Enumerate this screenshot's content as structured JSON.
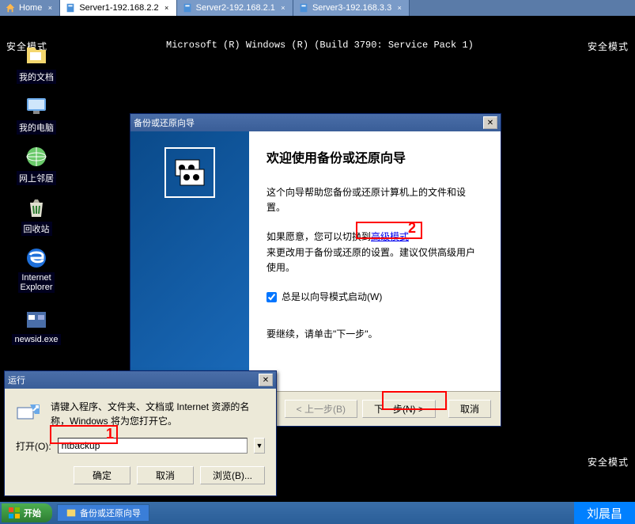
{
  "tabs": {
    "home": "Home",
    "t1": "Server1-192.168.2.2",
    "t2": "Server2-192.168.2.1",
    "t3": "Server3-192.168.3.3"
  },
  "safe_mode": "安全模式",
  "win_build": "Microsoft (R) Windows (R) (Build 3790: Service Pack 1)",
  "desktop_icons": {
    "docs": "我的文档",
    "computer": "我的电脑",
    "network": "网上邻居",
    "recycle": "回收站",
    "ie": "Internet\nExplorer",
    "newsid": "newsid.exe"
  },
  "wizard": {
    "title": "备份或还原向导",
    "heading": "欢迎使用备份或还原向导",
    "p1": "这个向导帮助您备份或还原计算机上的文件和设置。",
    "p2_a": "如果愿意，您可以切换到",
    "p2_link": "高级模式",
    "p2_b": "来更改用于备份或还原的设置。建议仅供高级用户使用。",
    "check": "总是以向导模式启动(W)",
    "p3": "要继续，请单击\"下一步\"。",
    "back": "< 上一步(B)",
    "next": "下一步(N) >",
    "cancel": "取消"
  },
  "run": {
    "title": "运行",
    "desc": "请键入程序、文件夹、文档或 Internet 资源的名称，Windows 将为您打开它。",
    "open_label": "打开(O):",
    "value": "ntbackup",
    "ok": "确定",
    "cancel": "取消",
    "browse": "浏览(B)..."
  },
  "taskbar": {
    "start": "开始",
    "item1": "备份或还原向导"
  },
  "anno": {
    "n1": "1",
    "n2": "2"
  },
  "name_tag": "刘晨昌"
}
